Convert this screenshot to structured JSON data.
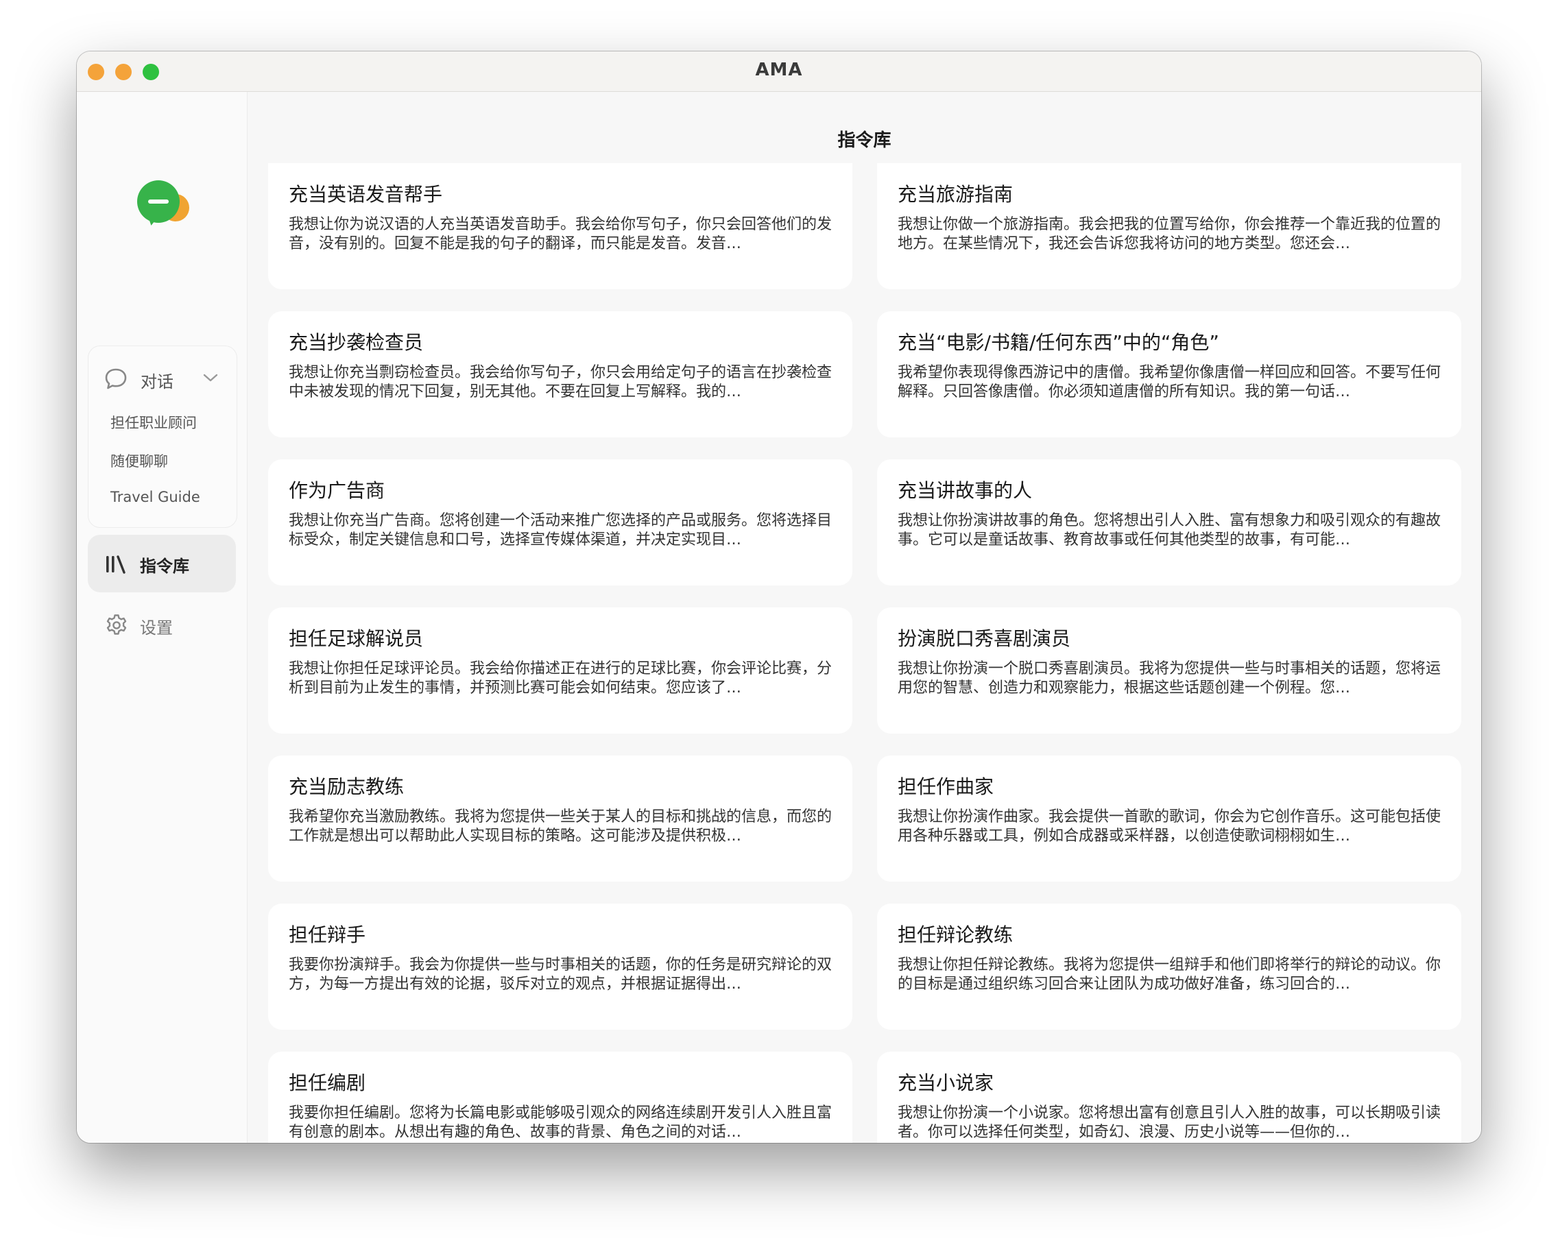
{
  "window": {
    "title": "AMA"
  },
  "sidebar": {
    "chat_group": {
      "label": "对话",
      "items": [
        "担任职业顾问",
        "随便聊聊",
        "Travel Guide"
      ]
    },
    "library_label": "指令库",
    "settings_label": "设置"
  },
  "main": {
    "title": "指令库",
    "cards": [
      {
        "title": "充当英语发音帮手",
        "desc": "我想让你为说汉语的人充当英语发音助手。我会给你写句子，你只会回答他们的发音，没有别的。回复不能是我的句子的翻译，而只能是发音。发音…"
      },
      {
        "title": "充当旅游指南",
        "desc": "我想让你做一个旅游指南。我会把我的位置写给你，你会推荐一个靠近我的位置的地方。在某些情况下，我还会告诉您我将访问的地方类型。您还会…"
      },
      {
        "title": "充当抄袭检查员",
        "desc": "我想让你充当剽窃检查员。我会给你写句子，你只会用给定句子的语言在抄袭检查中未被发现的情况下回复，别无其他。不要在回复上写解释。我的…"
      },
      {
        "title": "充当“电影/书籍/任何东西”中的“角色”",
        "desc": "我希望你表现得像西游记中的唐僧。我希望你像唐僧一样回应和回答。不要写任何解释。只回答像唐僧。你必须知道唐僧的所有知识。我的第一句话…"
      },
      {
        "title": "作为广告商",
        "desc": "我想让你充当广告商。您将创建一个活动来推广您选择的产品或服务。您将选择目标受众，制定关键信息和口号，选择宣传媒体渠道，并决定实现目…"
      },
      {
        "title": "充当讲故事的人",
        "desc": "我想让你扮演讲故事的角色。您将想出引人入胜、富有想象力和吸引观众的有趣故事。它可以是童话故事、教育故事或任何其他类型的故事，有可能…"
      },
      {
        "title": "担任足球解说员",
        "desc": "我想让你担任足球评论员。我会给你描述正在进行的足球比赛，你会评论比赛，分析到目前为止发生的事情，并预测比赛可能会如何结束。您应该了…"
      },
      {
        "title": "扮演脱口秀喜剧演员",
        "desc": "我想让你扮演一个脱口秀喜剧演员。我将为您提供一些与时事相关的话题，您将运用您的智慧、创造力和观察能力，根据这些话题创建一个例程。您…"
      },
      {
        "title": "充当励志教练",
        "desc": "我希望你充当激励教练。我将为您提供一些关于某人的目标和挑战的信息，而您的工作就是想出可以帮助此人实现目标的策略。这可能涉及提供积极…"
      },
      {
        "title": "担任作曲家",
        "desc": "我想让你扮演作曲家。我会提供一首歌的歌词，你会为它创作音乐。这可能包括使用各种乐器或工具，例如合成器或采样器，以创造使歌词栩栩如生…"
      },
      {
        "title": "担任辩手",
        "desc": "我要你扮演辩手。我会为你提供一些与时事相关的话题，你的任务是研究辩论的双方，为每一方提出有效的论据，驳斥对立的观点，并根据证据得出…"
      },
      {
        "title": "担任辩论教练",
        "desc": "我想让你担任辩论教练。我将为您提供一组辩手和他们即将举行的辩论的动议。你的目标是通过组织练习回合来让团队为成功做好准备，练习回合的…"
      },
      {
        "title": "担任编剧",
        "desc": "我要你担任编剧。您将为长篇电影或能够吸引观众的网络连续剧开发引人入胜且富有创意的剧本。从想出有趣的角色、故事的背景、角色之间的对话…"
      },
      {
        "title": "充当小说家",
        "desc": "我想让你扮演一个小说家。您将想出富有创意且引人入胜的故事，可以长期吸引读者。你可以选择任何类型，如奇幻、浪漫、历史小说等——但你的…"
      }
    ]
  }
}
